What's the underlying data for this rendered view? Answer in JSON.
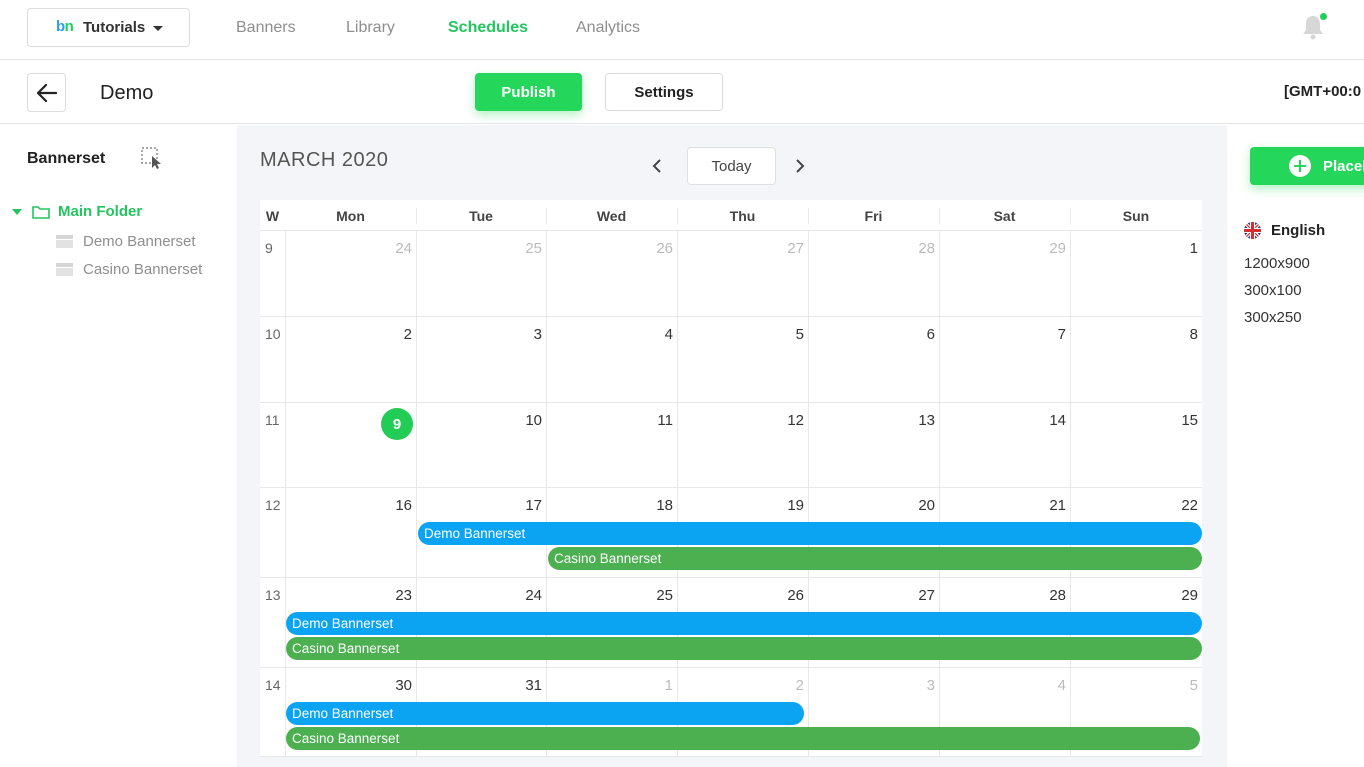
{
  "topnav": {
    "logo_b": "b",
    "logo_n": "n",
    "workspace": "Tutorials",
    "links": [
      "Banners",
      "Library",
      "Schedules",
      "Analytics"
    ],
    "active": "Schedules"
  },
  "subheader": {
    "title": "Demo",
    "publish_label": "Publish",
    "settings_label": "Settings",
    "timezone": "[GMT+00:0"
  },
  "sidebar": {
    "title": "Bannerset",
    "folder": "Main Folder",
    "items": [
      "Demo Bannerset",
      "Casino Bannerset"
    ]
  },
  "calendar": {
    "month": "MARCH 2020",
    "today_label": "Today",
    "headers": [
      "W",
      "Mon",
      "Tue",
      "Wed",
      "Thu",
      "Fri",
      "Sat",
      "Sun"
    ],
    "weeks": [
      {
        "num": "9",
        "days": [
          "24",
          "25",
          "26",
          "27",
          "28",
          "29",
          "1"
        ],
        "other": [
          true,
          true,
          true,
          true,
          true,
          true,
          false
        ]
      },
      {
        "num": "10",
        "days": [
          "2",
          "3",
          "4",
          "5",
          "6",
          "7",
          "8"
        ],
        "other": [
          false,
          false,
          false,
          false,
          false,
          false,
          false
        ]
      },
      {
        "num": "11",
        "days": [
          "9",
          "10",
          "11",
          "12",
          "13",
          "14",
          "15"
        ],
        "other": [
          false,
          false,
          false,
          false,
          false,
          false,
          false
        ]
      },
      {
        "num": "12",
        "days": [
          "16",
          "17",
          "18",
          "19",
          "20",
          "21",
          "22"
        ],
        "other": [
          false,
          false,
          false,
          false,
          false,
          false,
          false
        ]
      },
      {
        "num": "13",
        "days": [
          "23",
          "24",
          "25",
          "26",
          "27",
          "28",
          "29"
        ],
        "other": [
          false,
          false,
          false,
          false,
          false,
          false,
          false
        ]
      },
      {
        "num": "14",
        "days": [
          "30",
          "31",
          "1",
          "2",
          "3",
          "4",
          "5"
        ],
        "other": [
          false,
          false,
          true,
          true,
          true,
          true,
          true
        ]
      }
    ],
    "today_date": "9",
    "events": {
      "demo": "Demo Bannerset",
      "casino": "Casino Bannerset"
    },
    "colors": {
      "demo": "#0aa4f2",
      "casino": "#4caf50",
      "accent": "#22cc55"
    }
  },
  "rightpanel": {
    "place_label": "Placeholder",
    "language": "English",
    "sizes": [
      "1200x900",
      "300x100",
      "300x250"
    ]
  }
}
